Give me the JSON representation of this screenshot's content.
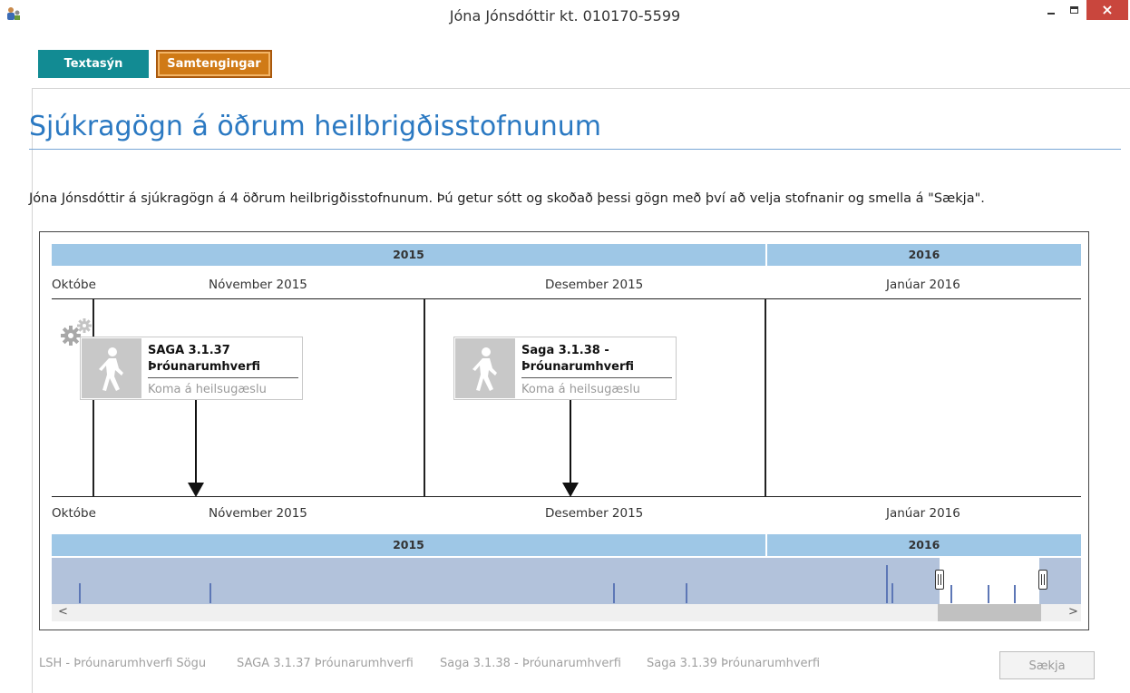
{
  "window": {
    "title": "Jóna Jónsdóttir kt. 010170-5599",
    "close_glyph": "×"
  },
  "tabs": [
    {
      "label": "Textasýn",
      "color": "#128b93"
    },
    {
      "label": "Samtengingar",
      "color": "#d07a16",
      "active": true
    }
  ],
  "page": {
    "title": "Sjúkragögn á öðrum heilbrigðisstofnunum",
    "info": "Jóna Jónsdóttir á sjúkragögn á 4 öðrum heilbrigðisstofnunum. Þú getur sótt og skoðað þessi gögn með því að velja stofnanir og smella á \"Sækja\"."
  },
  "timeline": {
    "years": [
      "2015",
      "2016"
    ],
    "months": [
      "Október",
      "Nóvember 2015",
      "Desember 2015",
      "Janúar 2016"
    ],
    "months_display": [
      "Októbe",
      "Nóvember 2015",
      "Desember 2015",
      "Janúar 2016"
    ],
    "events": [
      {
        "title_line1": "SAGA 3.1.37",
        "title_line2": "Þróunarumhverfi",
        "subtitle": "Koma á heilsugæslu"
      },
      {
        "title_line1": "Saga 3.1.38 -",
        "title_line2": "Þróunarumhverfi",
        "subtitle": "Koma á heilsugæslu"
      }
    ]
  },
  "footer": {
    "sources": [
      "LSH - Þróunarumhverfi Sögu",
      "SAGA 3.1.37 Þróunarumhverfi",
      "Saga 3.1.38 - Þróunarumhverfi",
      "Saga 3.1.39 Þróunarumhverfi"
    ],
    "fetch_button": "Sækja"
  },
  "scrollbar": {
    "left_arrow": "<",
    "right_arrow": ">"
  }
}
